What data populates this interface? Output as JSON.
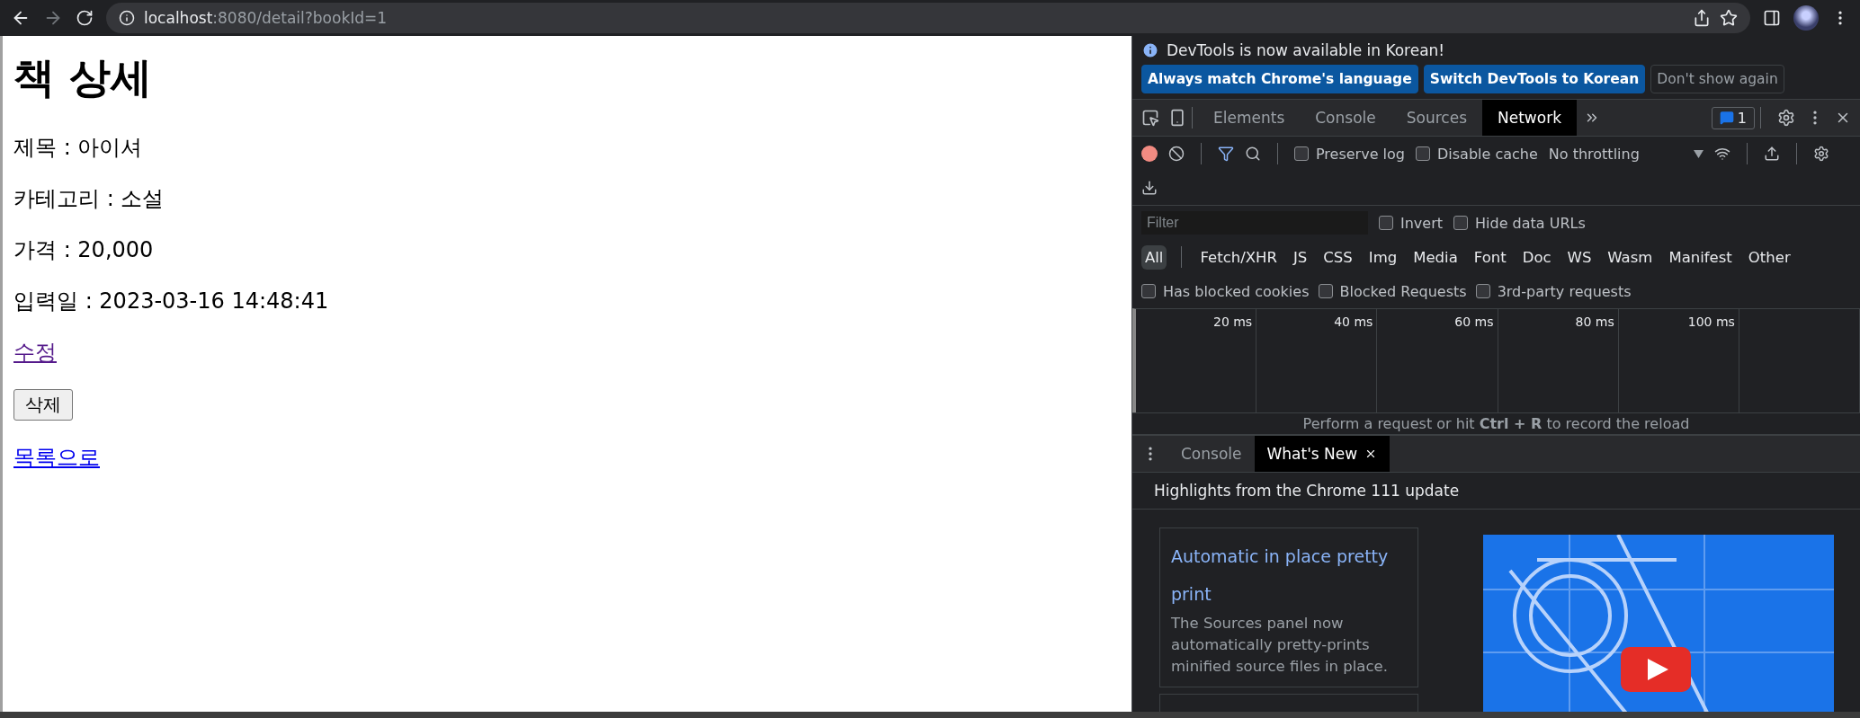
{
  "browser": {
    "url_host": "localhost",
    "url_rest": ":8080/detail?bookId=1"
  },
  "page": {
    "heading": "책 상세",
    "items": [
      {
        "kind": "text",
        "text": "제목 : 아이셔"
      },
      {
        "kind": "text",
        "text": "카테고리 : 소설"
      },
      {
        "kind": "text",
        "text": "가격 : 20,000"
      },
      {
        "kind": "text",
        "text": "입력일 : 2023-03-16 14:48:41"
      },
      {
        "kind": "link",
        "text": "수정",
        "visited": true
      },
      {
        "kind": "button",
        "text": "삭제"
      },
      {
        "kind": "link",
        "text": "목록으로",
        "visited": false
      }
    ]
  },
  "devtools": {
    "infobar": {
      "message": "DevTools is now available in Korean!",
      "buttons": [
        {
          "label": "Always match Chrome's language",
          "kind": "primary"
        },
        {
          "label": "Switch DevTools to Korean",
          "kind": "primary"
        },
        {
          "label": "Don't show again",
          "kind": "secondary"
        }
      ]
    },
    "tabs": [
      {
        "label": "Elements",
        "selected": false
      },
      {
        "label": "Console",
        "selected": false
      },
      {
        "label": "Sources",
        "selected": false
      },
      {
        "label": "Network",
        "selected": true
      }
    ],
    "issues_count": "1",
    "toolbar": {
      "recording": true,
      "checkboxes": [
        {
          "label": "Preserve log",
          "checked": false
        },
        {
          "label": "Disable cache",
          "checked": false
        }
      ],
      "throttling": "No throttling"
    },
    "filter": {
      "placeholder": "Filter",
      "checkboxes": [
        {
          "label": "Invert",
          "checked": false
        },
        {
          "label": "Hide data URLs",
          "checked": false
        }
      ]
    },
    "types": [
      {
        "label": "All",
        "selected": true
      },
      {
        "label": "Fetch/XHR",
        "selected": false
      },
      {
        "label": "JS",
        "selected": false
      },
      {
        "label": "CSS",
        "selected": false
      },
      {
        "label": "Img",
        "selected": false
      },
      {
        "label": "Media",
        "selected": false
      },
      {
        "label": "Font",
        "selected": false
      },
      {
        "label": "Doc",
        "selected": false
      },
      {
        "label": "WS",
        "selected": false
      },
      {
        "label": "Wasm",
        "selected": false
      },
      {
        "label": "Manifest",
        "selected": false
      },
      {
        "label": "Other",
        "selected": false
      }
    ],
    "blocked_checkboxes": [
      {
        "label": "Has blocked cookies",
        "checked": false
      },
      {
        "label": "Blocked Requests",
        "checked": false
      },
      {
        "label": "3rd-party requests",
        "checked": false
      }
    ],
    "timeline_ticks": [
      "20 ms",
      "40 ms",
      "60 ms",
      "80 ms",
      "100 ms"
    ],
    "empty_message": "Perform a request or hit **Ctrl + R** to record the reload",
    "drawer": {
      "tabs": [
        {
          "label": "Console",
          "selected": false,
          "closable": false
        },
        {
          "label": "What's New",
          "selected": true,
          "closable": true
        }
      ],
      "highlights": "Highlights from the Chrome 111 update",
      "cards": [
        {
          "title": "Automatic in place pretty print",
          "body": "The Sources panel now automatically pretty-prints minified source files in place."
        }
      ]
    }
  }
}
